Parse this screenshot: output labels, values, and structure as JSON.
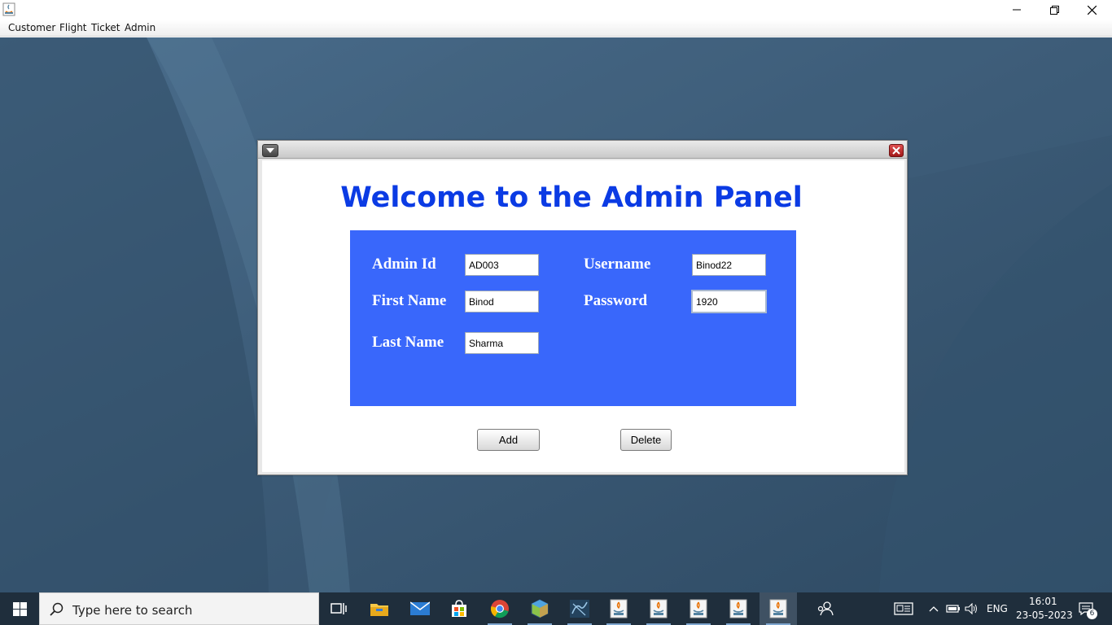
{
  "menubar": {
    "items": [
      {
        "label": "Customer"
      },
      {
        "label": "Flight"
      },
      {
        "label": "Ticket"
      },
      {
        "label": "Admin"
      }
    ]
  },
  "admin_frame": {
    "title": "Welcome to the Admin Panel",
    "fields": {
      "admin_id": {
        "label": "Admin Id",
        "value": "AD003"
      },
      "first_name": {
        "label": "First Name",
        "value": "Binod"
      },
      "last_name": {
        "label": "Last Name",
        "value": "Sharma"
      },
      "username": {
        "label": "Username",
        "value": "Binod22"
      },
      "password": {
        "label": "Password",
        "value": "1920"
      }
    },
    "buttons": {
      "add": "Add",
      "delete": "Delete"
    }
  },
  "taskbar": {
    "search_placeholder": "Type here to search",
    "apps": [
      "task-view",
      "file-explorer",
      "mail",
      "microsoft-store",
      "chrome",
      "virtualbox",
      "mysql-workbench",
      "java",
      "java",
      "java",
      "java",
      "java"
    ],
    "tray": {
      "language": "ENG",
      "time": "16:01",
      "date": "23-05-2023",
      "notifications": "6"
    }
  },
  "colors": {
    "title_text": "#0b3be4",
    "form_panel": "#3967fb",
    "desktop": "#3d5c78",
    "taskbar": "#1f2e3c"
  }
}
